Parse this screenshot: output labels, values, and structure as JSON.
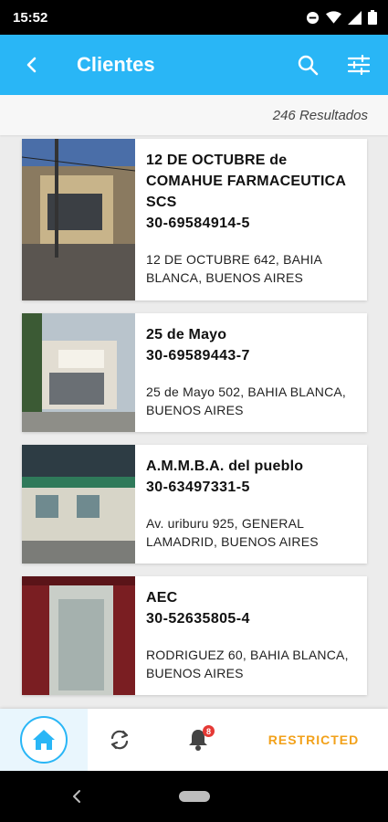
{
  "status_bar": {
    "time": "15:52"
  },
  "app_bar": {
    "title": "Clientes",
    "back_icon": "arrow-back-icon",
    "search_icon": "search-icon",
    "filter_icon": "tune-icon"
  },
  "results": {
    "count_text": "246 Resultados"
  },
  "clients": [
    {
      "name": "12 DE OCTUBRE de COMAHUE FARMACEUTICA SCS",
      "cuit": "30-69584914-5",
      "address": "12 DE OCTUBRE 642, BAHIA BLANCA, BUENOS AIRES"
    },
    {
      "name": "25 de Mayo",
      "cuit": "30-69589443-7",
      "address": "25 de Mayo 502, BAHIA BLANCA, BUENOS AIRES"
    },
    {
      "name": "A.M.M.B.A. del pueblo",
      "cuit": "30-63497331-5",
      "address": "Av. uriburu 925, GENERAL LAMADRID, BUENOS AIRES"
    },
    {
      "name": "AEC",
      "cuit": "30-52635805-4",
      "address": "RODRIGUEZ 60, BAHIA BLANCA, BUENOS AIRES"
    }
  ],
  "bottom_nav": {
    "home_icon": "home-icon",
    "sync_icon": "sync-icon",
    "bell_icon": "bell-icon",
    "notification_count": "8",
    "restricted_label": "RESTRICTED"
  },
  "colors": {
    "primary": "#29b6f6",
    "restricted": "#f2a11a",
    "badge": "#e53935"
  }
}
